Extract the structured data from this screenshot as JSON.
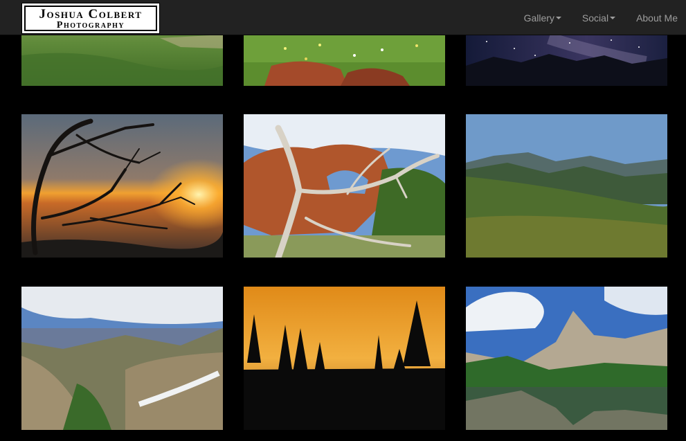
{
  "brand": {
    "line1": "Joshua Colbert",
    "line2": "Photography"
  },
  "nav": {
    "gallery_label": "Gallery",
    "social_label": "Social",
    "about_label": "About Me"
  },
  "gallery": {
    "photos": [
      {
        "subject": "green meadow hillside"
      },
      {
        "subject": "wildflowers and red rocks"
      },
      {
        "subject": "milky way over mountains"
      },
      {
        "subject": "dead tree at sunset"
      },
      {
        "subject": "rock arch with dead juniper"
      },
      {
        "subject": "green mountain meadow"
      },
      {
        "subject": "alpine cirque with snow"
      },
      {
        "subject": "pine silhouettes at orange sunset"
      },
      {
        "subject": "peak reflected in alpine lake"
      }
    ]
  },
  "colors": {
    "navbar": "#222222",
    "nav_text": "#9d9d9d",
    "page_bg": "#000000"
  }
}
